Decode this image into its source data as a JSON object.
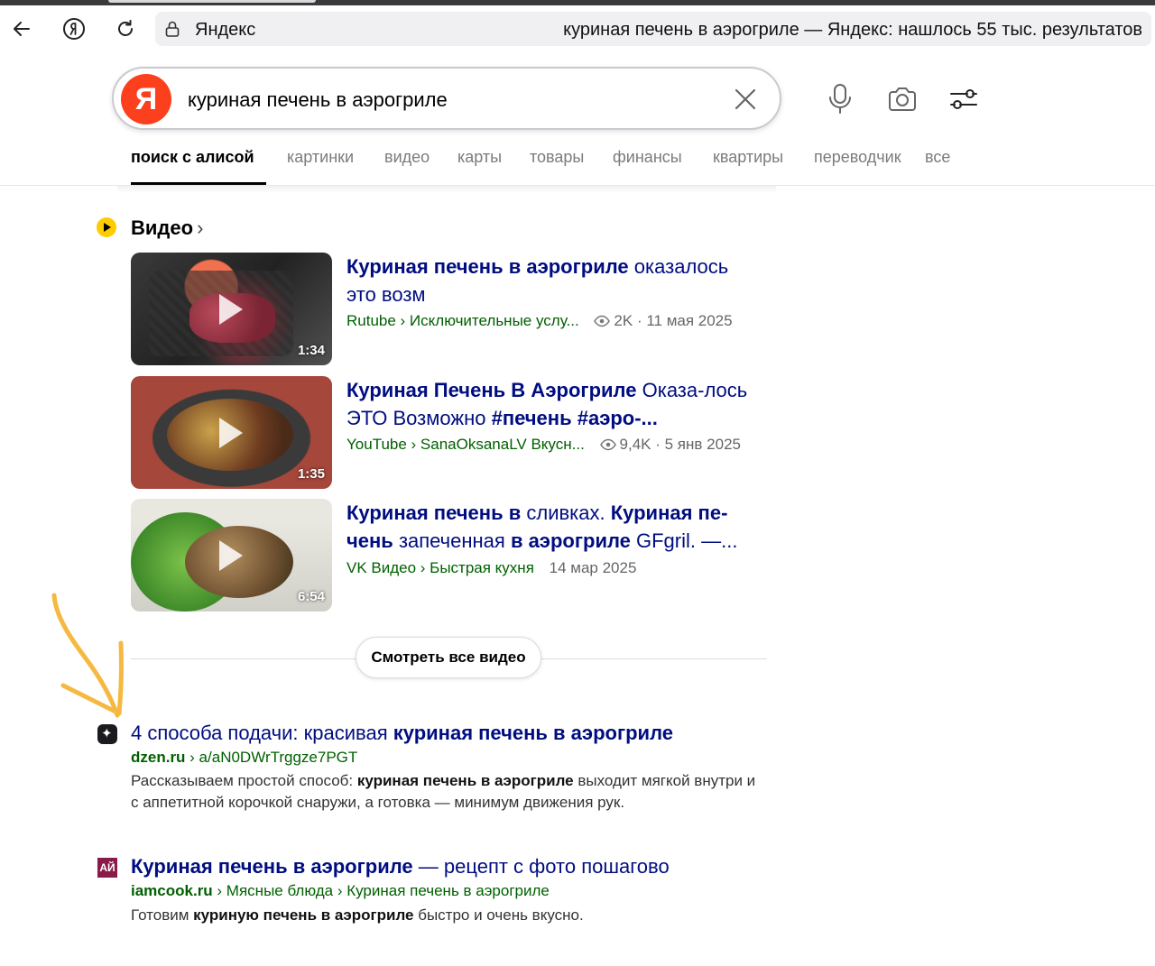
{
  "browser": {
    "host": "Яндекс",
    "page_title": "куриная печень в аэрогриле — Яндекс: нашлось 55 тыс. результатов"
  },
  "search": {
    "logo": "Я",
    "query": "куриная печень в аэрогриле"
  },
  "tabs": [
    "поиск с алисой",
    "картинки",
    "видео",
    "карты",
    "товары",
    "финансы",
    "квартиры",
    "переводчик",
    "все"
  ],
  "video_section": {
    "heading": "Видео",
    "chevron": "›",
    "items": [
      {
        "duration": "1:34",
        "title_bold": "Куриная печень в аэрогриле",
        "title_rest": " оказалось это возм",
        "source": "Rutube › Исключительные услу...",
        "views": "2K",
        "date": "· 11 мая 2025"
      },
      {
        "duration": "1:35",
        "title_bold": "Куриная Печень В Аэрогриле",
        "title_rest": " Оказа-лось ЭТО Возможно ",
        "title_bold2": "#печень #аэро-...",
        "source": "YouTube › SanaOksanaLV Вкусн...",
        "views": "9,4K",
        "date": "· 5 янв 2025"
      },
      {
        "duration": "6:54",
        "title_bold": "Куриная печень в",
        "title_rest": " сливках. ",
        "title_bold2": "Куриная пе-чень",
        "title_rest2": " запеченная ",
        "title_bold3": "в аэрогриле",
        "title_rest3": " GFgril. —...",
        "source": "VK Видео › Быстрая кухня",
        "date": "14 мар 2025"
      }
    ],
    "all_button": "Смотреть все видео"
  },
  "results": [
    {
      "title_plain": "4 способа подачи: красивая ",
      "title_bold": "куриная печень в аэрогриле",
      "domain": "dzen.ru",
      "path": " › a/aN0DWrTrggze7PGT",
      "snippet_a": "Рассказываем простой способ: ",
      "snippet_bold": "куриная печень в аэрогриле",
      "snippet_b": " выходит мягкой внутри и с аппетитной корочкой снаружи, а готовка — минимум движения рук."
    },
    {
      "favicon_text": "АЙ",
      "title_bold": "Куриная печень в аэрогриле",
      "title_plain": " — рецепт с фото пошагово",
      "domain": "iamcook.ru",
      "path": " › Мясные блюда › Куриная печень в аэрогриле",
      "snippet_a": "Готовим ",
      "snippet_bold": "куриную печень в аэрогриле",
      "snippet_b": " быстро и очень вкусно."
    }
  ],
  "colors": {
    "brand_red": "#fc3f1d",
    "link_blue": "#000d80",
    "url_green": "#006000",
    "annotation_arrow": "#f5b942"
  }
}
